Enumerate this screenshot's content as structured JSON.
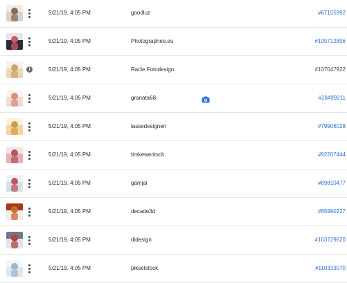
{
  "rows": [
    {
      "date": "5/21/19, 4:05 PM",
      "contributor": "goodluz",
      "asset_id": "#67155992",
      "id_linked": true,
      "action": "more-options",
      "thumb_colors": [
        "#d9d2cc",
        "#8a6a55",
        "#f1ece7"
      ]
    },
    {
      "date": "5/21/19, 4:05 PM",
      "contributor": "Photographee.eu",
      "asset_id": "#105712856",
      "id_linked": true,
      "action": "more-options",
      "thumb_colors": [
        "#2d2a35",
        "#c85a64",
        "#e8e4ee"
      ]
    },
    {
      "date": "5/21/19, 4:05 PM",
      "contributor": "Racle Fotodesign",
      "asset_id": "#107047922",
      "id_linked": false,
      "action": "info",
      "thumb_colors": [
        "#e9d9b5",
        "#caa46a",
        "#f7f1e6"
      ]
    },
    {
      "date": "5/21/19, 4:05 PM",
      "contributor": "granata68",
      "asset_id": "#28499211",
      "id_linked": true,
      "action": "more-options",
      "has_camera_icon": true,
      "thumb_colors": [
        "#efdcd4",
        "#d88f7d",
        "#faf3ee"
      ]
    },
    {
      "date": "5/21/19, 4:05 PM",
      "contributor": "lassedesignen",
      "asset_id": "#79906028",
      "id_linked": true,
      "action": "more-options",
      "thumb_colors": [
        "#f2d79a",
        "#d49b50",
        "#fbf1da"
      ]
    },
    {
      "date": "5/21/19, 4:05 PM",
      "contributor": "timkeweritsch",
      "asset_id": "#92207444",
      "id_linked": true,
      "action": "more-options",
      "thumb_colors": [
        "#e6b2b4",
        "#b5555f",
        "#f6e3e3"
      ]
    },
    {
      "date": "5/21/19, 4:05 PM",
      "contributor": "gamjai",
      "asset_id": "#89810477",
      "id_linked": true,
      "action": "more-options",
      "thumb_colors": [
        "#d4e0ea",
        "#c25560",
        "#eef3f7"
      ]
    },
    {
      "date": "5/21/19, 4:05 PM",
      "contributor": "decade3d",
      "asset_id": "#85990227",
      "id_linked": true,
      "action": "more-options",
      "thumb_colors": [
        "#f3eeea",
        "#d0662c",
        "#a33b17"
      ]
    },
    {
      "date": "5/21/19, 4:05 PM",
      "contributor": "didesign",
      "asset_id": "#103729620",
      "id_linked": true,
      "action": "more-options",
      "thumb_colors": [
        "#e2e4e8",
        "#b34146",
        "#6f7a86"
      ]
    },
    {
      "date": "5/21/19, 4:05 PM",
      "contributor": "pikselstock",
      "asset_id": "#110323070",
      "id_linked": true,
      "action": "more-options",
      "thumb_colors": [
        "#dfe8ee",
        "#9fb7c9",
        "#f4f7f9"
      ]
    }
  ],
  "icons": {
    "more": "more-options-icon",
    "info": "info-icon",
    "camera": "camera-icon"
  },
  "colors": {
    "link": "#2d6fd0",
    "divider": "#e6e6e6",
    "camera": "#2d6fd0"
  }
}
